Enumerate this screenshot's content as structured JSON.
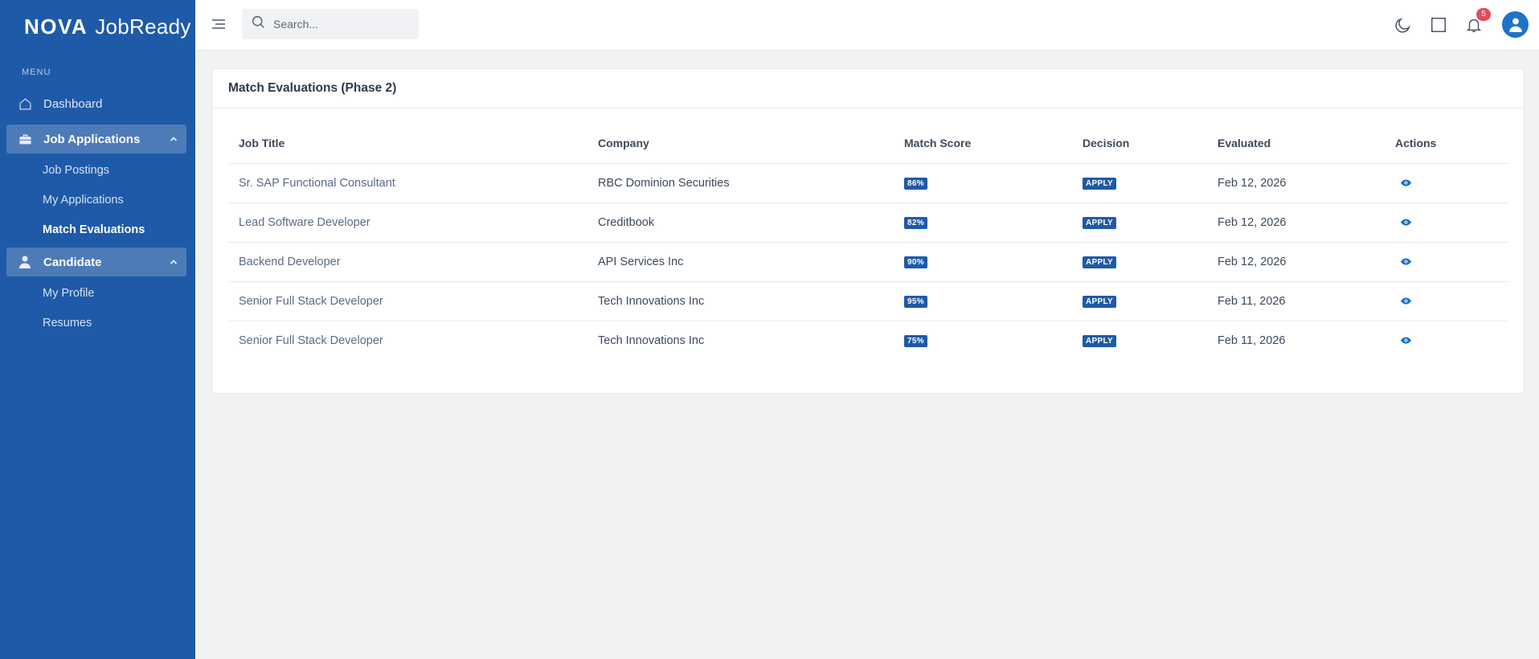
{
  "brand": {
    "part1": "NOVA",
    "part2": "JobReady"
  },
  "sidebar": {
    "menu_label": "MENU",
    "dashboard": "Dashboard",
    "job_applications": {
      "label": "Job Applications",
      "items": [
        "Job Postings",
        "My Applications",
        "Match Evaluations"
      ]
    },
    "candidate": {
      "label": "Candidate",
      "items": [
        "My Profile",
        "Resumes"
      ]
    }
  },
  "header": {
    "search_placeholder": "Search...",
    "notification_count": "5"
  },
  "card": {
    "title": "Match Evaluations (Phase 2)",
    "columns": [
      "Job Title",
      "Company",
      "Match Score",
      "Decision",
      "Evaluated",
      "Actions"
    ],
    "rows": [
      {
        "job_title": "Sr. SAP Functional Consultant",
        "company": "RBC Dominion Securities",
        "score": "86%",
        "decision": "APPLY",
        "evaluated": "Feb 12, 2026"
      },
      {
        "job_title": "Lead Software Developer",
        "company": "Creditbook",
        "score": "82%",
        "decision": "APPLY",
        "evaluated": "Feb 12, 2026"
      },
      {
        "job_title": "Backend Developer",
        "company": "API Services Inc",
        "score": "90%",
        "decision": "APPLY",
        "evaluated": "Feb 12, 2026"
      },
      {
        "job_title": "Senior Full Stack Developer",
        "company": "Tech Innovations Inc",
        "score": "95%",
        "decision": "APPLY",
        "evaluated": "Feb 11, 2026"
      },
      {
        "job_title": "Senior Full Stack Developer",
        "company": "Tech Innovations Inc",
        "score": "75%",
        "decision": "APPLY",
        "evaluated": "Feb 11, 2026"
      }
    ]
  },
  "colors": {
    "sidebar_bg": "#1e5aa7",
    "active_item": "#4d7bb7",
    "badge_bg": "#e44b5b",
    "pill_bg": "#1e5aa7"
  },
  "icons": [
    "home-icon",
    "briefcase-icon",
    "user-icon",
    "chevron-up-icon",
    "menu-icon",
    "search-icon",
    "moon-icon",
    "fullscreen-icon",
    "bell-icon",
    "avatar-icon",
    "eye-icon"
  ]
}
